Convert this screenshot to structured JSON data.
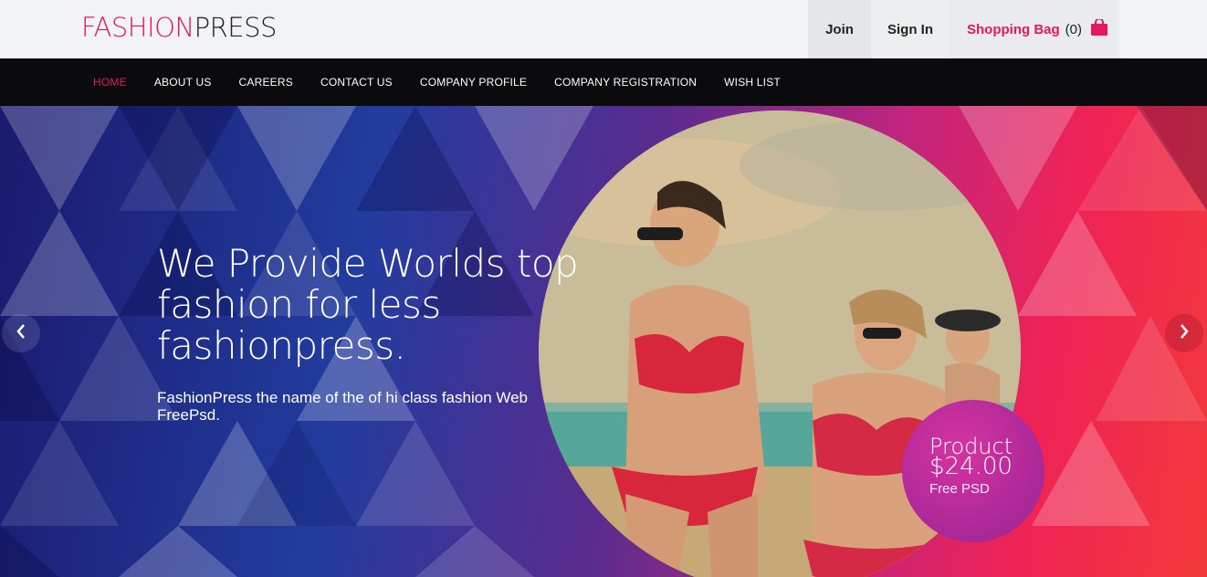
{
  "brand": {
    "part1": "FASHION",
    "part2": "PRESS"
  },
  "header": {
    "join_label": "Join",
    "signin_label": "Sign In",
    "bag_label": "Shopping Bag",
    "bag_count": "(0)",
    "bag_icon": "shopping-bag-icon"
  },
  "nav": {
    "items": [
      {
        "label": "HOME",
        "active": true
      },
      {
        "label": "ABOUT US"
      },
      {
        "label": "CAREERS"
      },
      {
        "label": "CONTACT US"
      },
      {
        "label": "COMPANY PROFILE"
      },
      {
        "label": "COMPANY REGISTRATION"
      },
      {
        "label": "WISH LIST"
      }
    ]
  },
  "hero": {
    "heading_lines": [
      "We Provide Worlds top",
      "fashion for less",
      "fashionpress."
    ],
    "subtext": "FashionPress the name of the of hi class fashion Web FreePsd.",
    "badge": {
      "line1": "Product",
      "line2": "$24.00",
      "line3": "Free PSD"
    },
    "prev_icon": "chevron-left-icon",
    "next_icon": "chevron-right-icon"
  },
  "colors": {
    "accent": "#e8175d",
    "nav_bg": "#0b0b0d",
    "topbar_bg": "#f2f3f4"
  }
}
